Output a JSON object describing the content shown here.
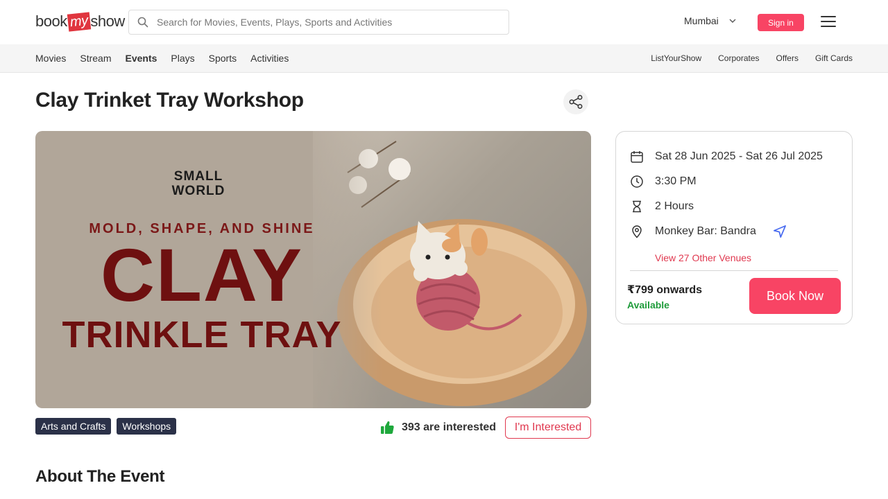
{
  "header": {
    "logo": {
      "part1": "book",
      "part2": "my",
      "part3": "show"
    },
    "search_placeholder": "Search for Movies, Events, Plays, Sports and Activities",
    "city": "Mumbai",
    "signin_label": "Sign in"
  },
  "nav": {
    "left": [
      "Movies",
      "Stream",
      "Events",
      "Plays",
      "Sports",
      "Activities"
    ],
    "active": "Events",
    "right": [
      "ListYourShow",
      "Corporates",
      "Offers",
      "Gift Cards"
    ]
  },
  "event": {
    "title": "Clay Trinket Tray Workshop",
    "banner": {
      "brand_line1": "SMALL",
      "brand_line2": "WORLD",
      "tagline": "MOLD, SHAPE, AND SHINE",
      "headline": "CLAY",
      "subheadline": "TRINKLE TRAY"
    },
    "tags": [
      "Arts and Crafts",
      "Workshops"
    ],
    "interested_count": "393 are interested",
    "interested_button": "I'm Interested",
    "about_heading": "About The Event"
  },
  "details": {
    "dates": "Sat 28 Jun 2025 - Sat 26 Jul 2025",
    "time": "3:30 PM",
    "duration": "2 Hours",
    "venue": "Monkey Bar: Bandra",
    "venues_link": "View 27 Other Venues",
    "price": "₹799 onwards",
    "availability": "Available",
    "book_button": "Book Now"
  },
  "colors": {
    "brand_red": "#f84464",
    "tag_bg": "#2b3148",
    "available_green": "#1e9b3a",
    "banner_text": "#6e1010"
  },
  "icons": [
    "search-icon",
    "chevron-down-icon",
    "hamburger-menu-icon",
    "share-icon",
    "thumbs-up-icon",
    "calendar-icon",
    "clock-icon",
    "hourglass-icon",
    "location-pin-icon",
    "navigate-arrow-icon"
  ]
}
